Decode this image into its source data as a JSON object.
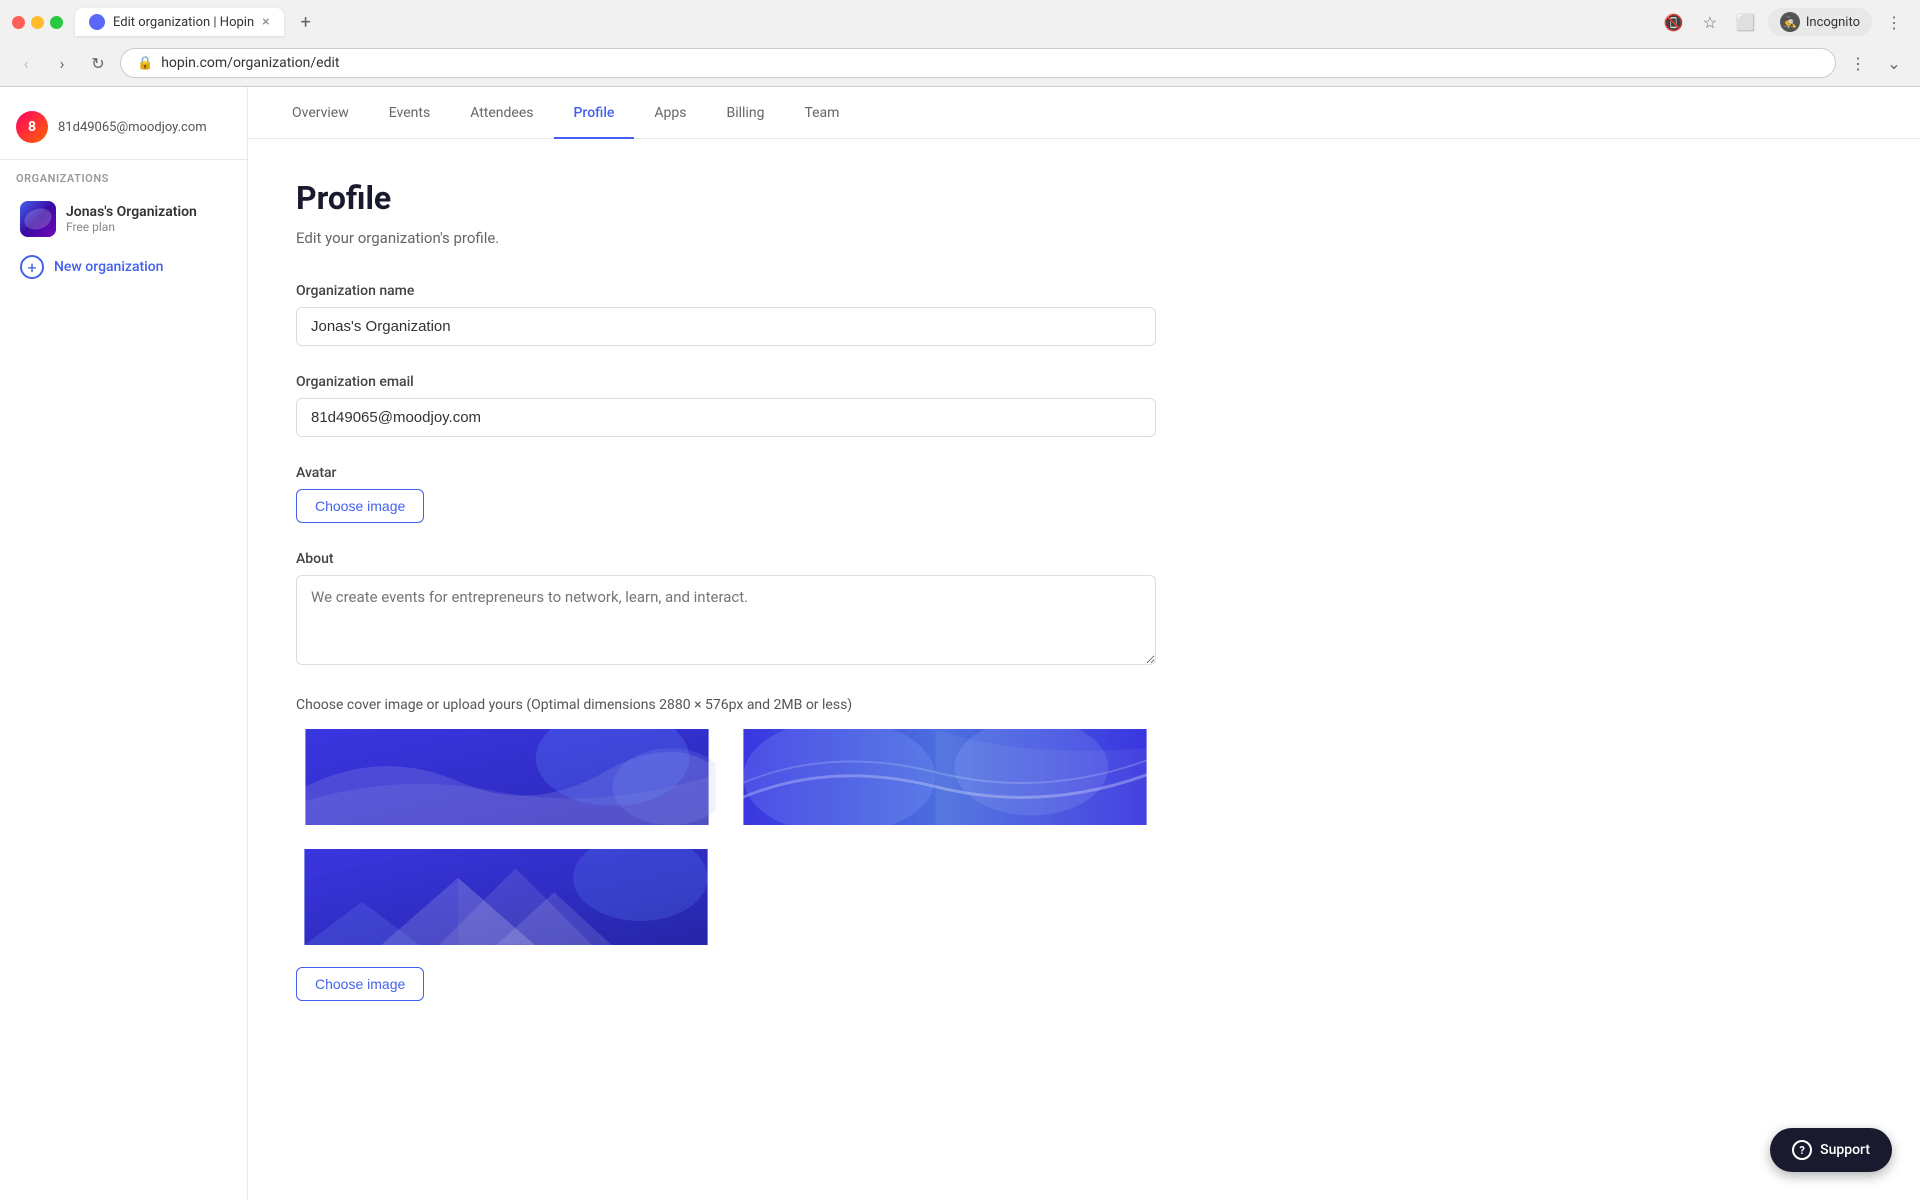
{
  "browser": {
    "tab_title": "Edit organization | Hopin",
    "tab_close": "×",
    "new_tab": "+",
    "url": "hopin.com/organization/edit",
    "incognito_label": "Incognito",
    "nav_dots": {
      "expand": "⌄"
    }
  },
  "sidebar": {
    "user_email": "81d49065@moodjoy.com",
    "user_initial": "8",
    "section_label": "ORGANIZATIONS",
    "org": {
      "name": "Jonas's Organization",
      "plan": "Free plan"
    },
    "new_org_label": "New organization"
  },
  "top_nav": {
    "items": [
      {
        "label": "Overview",
        "active": false
      },
      {
        "label": "Events",
        "active": false
      },
      {
        "label": "Attendees",
        "active": false
      },
      {
        "label": "Profile",
        "active": true
      },
      {
        "label": "Apps",
        "active": false
      },
      {
        "label": "Billing",
        "active": false
      },
      {
        "label": "Team",
        "active": false
      }
    ]
  },
  "profile": {
    "title": "Profile",
    "subtitle": "Edit your organization's profile.",
    "org_name_label": "Organization name",
    "org_name_value": "Jonas's Organization",
    "org_email_label": "Organization email",
    "org_email_value": "81d49065@moodjoy.com",
    "avatar_label": "Avatar",
    "choose_image_btn": "Choose image",
    "about_label": "About",
    "about_placeholder": "We create events for entrepreneurs to network, learn, and interact.",
    "cover_label": "Choose cover image or upload yours (Optimal dimensions 2880 × 576px and 2MB or less)",
    "choose_cover_btn": "Choose image"
  },
  "support": {
    "label": "Support"
  },
  "colors": {
    "accent": "#4361ee",
    "cover1_bg": "#3730d4",
    "cover2_bg": "#3730d4",
    "cover3_bg": "#3730d4"
  }
}
